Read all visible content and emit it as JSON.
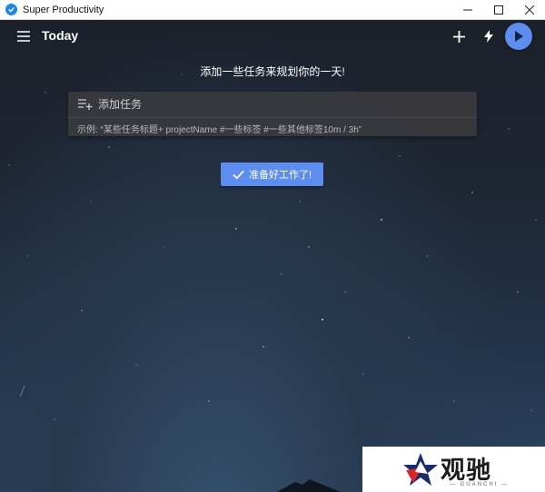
{
  "window": {
    "title": "Super Productivity"
  },
  "header": {
    "title": "Today",
    "icons": {
      "menu": "menu-icon",
      "add": "plus-icon",
      "bolt": "lightning-icon",
      "play": "play-icon"
    }
  },
  "main": {
    "prompt": "添加一些任务来规划你的一天!",
    "add_task": {
      "placeholder": "添加任务",
      "example": "示例: “某些任务标题+ projectName #一些标签 #一些其他标签10m / 3h”"
    },
    "ready_button": {
      "label": "准备好工作了!"
    }
  },
  "watermark": {
    "name": "观驰",
    "sub": "— GUANCHI —"
  },
  "colors": {
    "accent": "#5c8def",
    "panel": "#3a3a3e",
    "titlebar": "#ffffff"
  }
}
